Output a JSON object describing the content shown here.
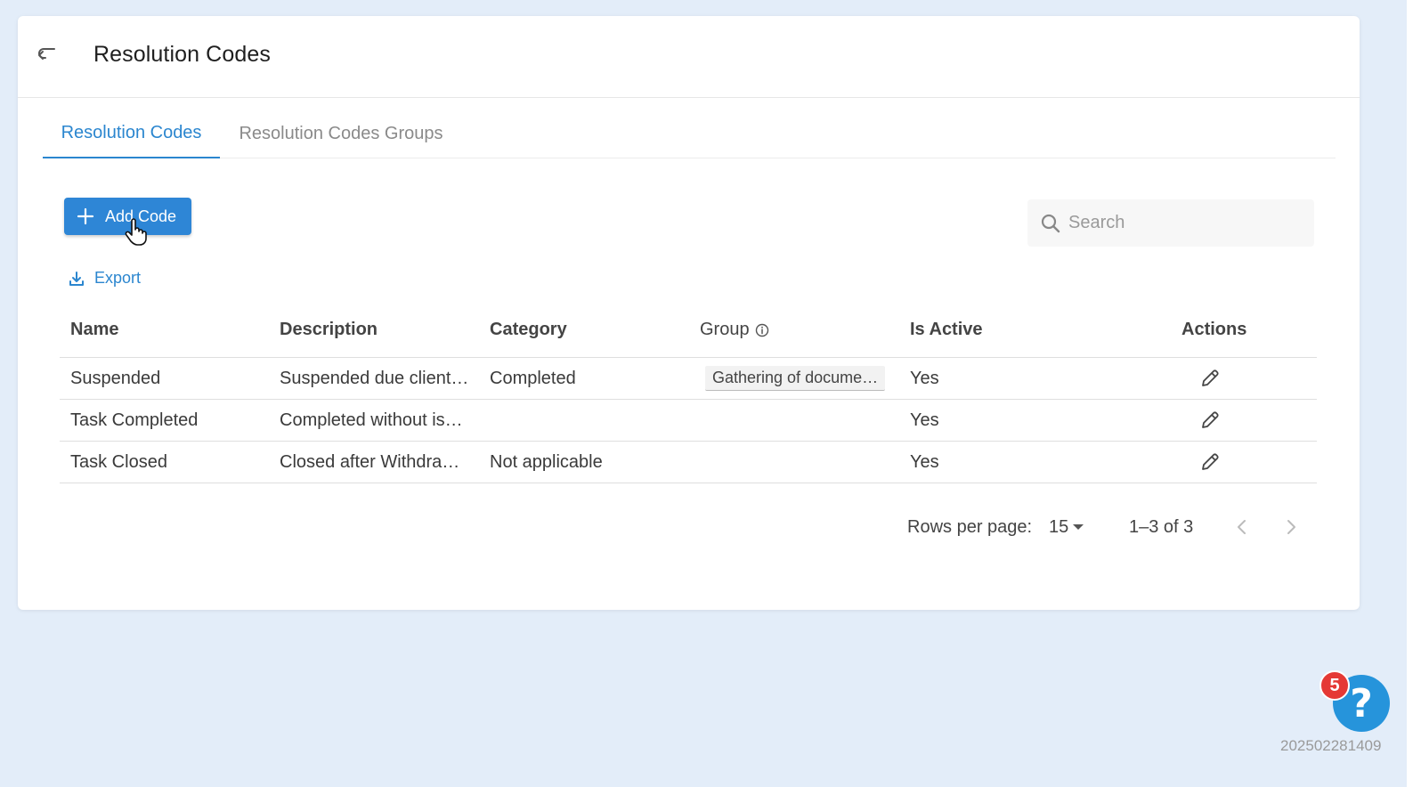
{
  "header": {
    "title": "Resolution Codes"
  },
  "tabs": [
    {
      "label": "Resolution Codes",
      "active": true
    },
    {
      "label": "Resolution Codes Groups",
      "active": false
    }
  ],
  "toolbar": {
    "add_label": "Add Code",
    "export_label": "Export",
    "search_placeholder": "Search"
  },
  "table": {
    "columns": [
      "Name",
      "Description",
      "Category",
      "Group",
      "Is Active",
      "Actions"
    ],
    "rows": [
      {
        "name": "Suspended",
        "description": "Suspended due client…",
        "category": "Completed",
        "group": "Gathering of docume…",
        "is_active": "Yes"
      },
      {
        "name": "Task Completed",
        "description": "Completed without is…",
        "category": "",
        "group": "",
        "is_active": "Yes"
      },
      {
        "name": "Task Closed",
        "description": "Closed after Withdra…",
        "category": "Not applicable",
        "group": "",
        "is_active": "Yes"
      }
    ]
  },
  "pagination": {
    "rows_per_page_label": "Rows per page:",
    "rows_per_page_value": "15",
    "range_text": "1–3 of 3"
  },
  "help": {
    "badge_count": "5",
    "label": "?"
  },
  "footer": {
    "build": "202502281409"
  },
  "colors": {
    "accent": "#2b86cf",
    "badge": "#e53935",
    "help": "#2694db"
  }
}
